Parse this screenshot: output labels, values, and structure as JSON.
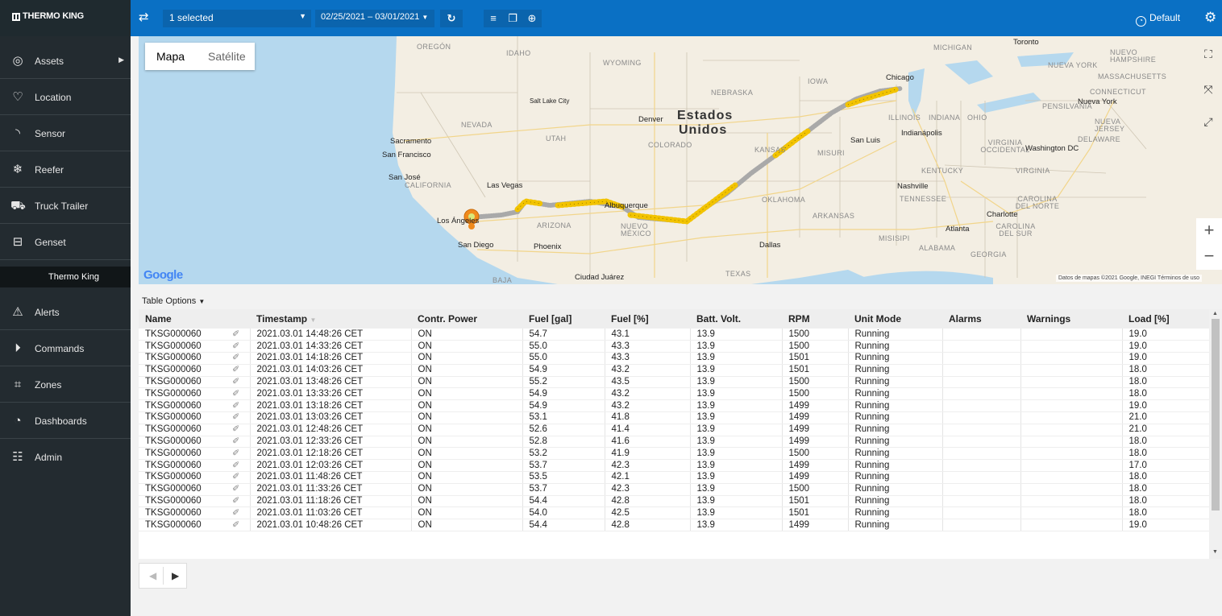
{
  "brand": {
    "name": "THERMO KING"
  },
  "toolbar": {
    "asset_select": "1 selected",
    "date_range": "02/25/2021 – 03/01/2021",
    "default_label": "Default"
  },
  "sidebar": {
    "items": [
      {
        "label": "Assets",
        "icon": "target-icon"
      },
      {
        "label": "Location",
        "icon": "map-pin-icon"
      },
      {
        "label": "Sensor",
        "icon": "signal-icon"
      },
      {
        "label": "Reefer",
        "icon": "snowflake-icon"
      },
      {
        "label": "Truck Trailer",
        "icon": "truck-icon"
      },
      {
        "label": "Genset",
        "icon": "genset-icon"
      },
      {
        "label": "Alerts",
        "icon": "warning-icon"
      },
      {
        "label": "Commands",
        "icon": "play-circle-icon"
      },
      {
        "label": "Zones",
        "icon": "zones-icon"
      },
      {
        "label": "Dashboards",
        "icon": "gauge-icon"
      },
      {
        "label": "Admin",
        "icon": "users-icon"
      }
    ],
    "sub_item": "Thermo King"
  },
  "map": {
    "type_map": "Mapa",
    "type_satellite": "Satélite",
    "logo": "Google",
    "attribution": "Datos de mapas ©2021 Google, INEGI   Términos de uso",
    "labels": {
      "oregon": "OREGÓN",
      "idaho": "IDAHO",
      "wyoming": "WYOMING",
      "nevada": "NEVADA",
      "utah": "UTAH",
      "colorado": "COLORADO",
      "california": "CALIFORNIA",
      "arizona": "ARIZONA",
      "nebraska": "NEBRASKA",
      "kansas": "KANSAS",
      "iowa": "IOWA",
      "oklahoma": "OKLAHOMA",
      "texas": "TEXAS",
      "mexico": "NUEVO MÉXICO",
      "missouri": "MISURI",
      "arkansas": "ARKANSAS",
      "mississippi": "MISISIPI",
      "alabama": "ALABAMA",
      "georgia": "GEORGIA",
      "tennessee": "TENNESSEE",
      "kentucky": "KENTUCKY",
      "illinois": "ILLINOIS",
      "indiana": "INDIANA",
      "ohio": "OHIO",
      "michigan": "MICHIGAN",
      "pennsylvania": "PENSILVANIA",
      "newyork": "NUEVA YORK",
      "newhampshire": "NUEVO HAMPSHIRE",
      "massachusetts": "MASSACHUSETTS",
      "connecticut": "CONNECTICUT",
      "newjersey": "NUEVA JERSEY",
      "delaware": "DELAWARE",
      "westvirginia": "VIRGINIA OCCIDENTAL",
      "virginia": "VIRGINIA",
      "ncarolina": "CAROLINA DEL NORTE",
      "scarolina": "CAROLINA DEL SUR",
      "baja": "BAJA",
      "country1": "Estados",
      "country2": "Unidos",
      "slc": "Salt Lake City",
      "denver": "Denver",
      "sacramento": "Sacramento",
      "sanfrancisco": "San Francisco",
      "sanjose": "San José",
      "lasvegas": "Las Vegas",
      "losangeles": "Los Ángeles",
      "sandiego": "San Diego",
      "phoenix": "Phoenix",
      "albuquerque": "Albuquerque",
      "ciudadjuarez": "Ciudad Juárez",
      "dallas": "Dallas",
      "chicago": "Chicago",
      "indianapolis": "Indianápolis",
      "stlouis": "San Luis",
      "nashville": "Nashville",
      "atlanta": "Atlanta",
      "charlotte": "Charlotte",
      "washington": "Washington DC",
      "newyorkcity": "Nueva York",
      "toronto": "Toronto"
    }
  },
  "table": {
    "options_label": "Table Options",
    "columns": [
      "Name",
      "Timestamp",
      "Contr. Power",
      "Fuel [gal]",
      "Fuel [%]",
      "Batt. Volt.",
      "RPM",
      "Unit Mode",
      "Alarms",
      "Warnings",
      "Load [%]"
    ],
    "rows": [
      [
        "TKSG000060",
        "2021.03.01 14:48:26 CET",
        "ON",
        "54.7",
        "43.1",
        "13.9",
        "1500",
        "Running",
        "",
        "",
        "19.0"
      ],
      [
        "TKSG000060",
        "2021.03.01 14:33:26 CET",
        "ON",
        "55.0",
        "43.3",
        "13.9",
        "1500",
        "Running",
        "",
        "",
        "19.0"
      ],
      [
        "TKSG000060",
        "2021.03.01 14:18:26 CET",
        "ON",
        "55.0",
        "43.3",
        "13.9",
        "1501",
        "Running",
        "",
        "",
        "19.0"
      ],
      [
        "TKSG000060",
        "2021.03.01 14:03:26 CET",
        "ON",
        "54.9",
        "43.2",
        "13.9",
        "1501",
        "Running",
        "",
        "",
        "18.0"
      ],
      [
        "TKSG000060",
        "2021.03.01 13:48:26 CET",
        "ON",
        "55.2",
        "43.5",
        "13.9",
        "1500",
        "Running",
        "",
        "",
        "18.0"
      ],
      [
        "TKSG000060",
        "2021.03.01 13:33:26 CET",
        "ON",
        "54.9",
        "43.2",
        "13.9",
        "1500",
        "Running",
        "",
        "",
        "18.0"
      ],
      [
        "TKSG000060",
        "2021.03.01 13:18:26 CET",
        "ON",
        "54.9",
        "43.2",
        "13.9",
        "1499",
        "Running",
        "",
        "",
        "19.0"
      ],
      [
        "TKSG000060",
        "2021.03.01 13:03:26 CET",
        "ON",
        "53.1",
        "41.8",
        "13.9",
        "1499",
        "Running",
        "",
        "",
        "21.0"
      ],
      [
        "TKSG000060",
        "2021.03.01 12:48:26 CET",
        "ON",
        "52.6",
        "41.4",
        "13.9",
        "1499",
        "Running",
        "",
        "",
        "21.0"
      ],
      [
        "TKSG000060",
        "2021.03.01 12:33:26 CET",
        "ON",
        "52.8",
        "41.6",
        "13.9",
        "1499",
        "Running",
        "",
        "",
        "18.0"
      ],
      [
        "TKSG000060",
        "2021.03.01 12:18:26 CET",
        "ON",
        "53.2",
        "41.9",
        "13.9",
        "1500",
        "Running",
        "",
        "",
        "18.0"
      ],
      [
        "TKSG000060",
        "2021.03.01 12:03:26 CET",
        "ON",
        "53.7",
        "42.3",
        "13.9",
        "1499",
        "Running",
        "",
        "",
        "17.0"
      ],
      [
        "TKSG000060",
        "2021.03.01 11:48:26 CET",
        "ON",
        "53.5",
        "42.1",
        "13.9",
        "1499",
        "Running",
        "",
        "",
        "18.0"
      ],
      [
        "TKSG000060",
        "2021.03.01 11:33:26 CET",
        "ON",
        "53.7",
        "42.3",
        "13.9",
        "1500",
        "Running",
        "",
        "",
        "18.0"
      ],
      [
        "TKSG000060",
        "2021.03.01 11:18:26 CET",
        "ON",
        "54.4",
        "42.8",
        "13.9",
        "1501",
        "Running",
        "",
        "",
        "18.0"
      ],
      [
        "TKSG000060",
        "2021.03.01 11:03:26 CET",
        "ON",
        "54.0",
        "42.5",
        "13.9",
        "1501",
        "Running",
        "",
        "",
        "18.0"
      ],
      [
        "TKSG000060",
        "2021.03.01 10:48:26 CET",
        "ON",
        "54.4",
        "42.8",
        "13.9",
        "1499",
        "Running",
        "",
        "",
        "19.0"
      ]
    ]
  },
  "colors": {
    "topbar": "#0a70c4",
    "sidebar": "#232b30",
    "track_point": "#f2c300",
    "track_gray": "#a9a9a9",
    "current_marker": "#f08a1c"
  }
}
